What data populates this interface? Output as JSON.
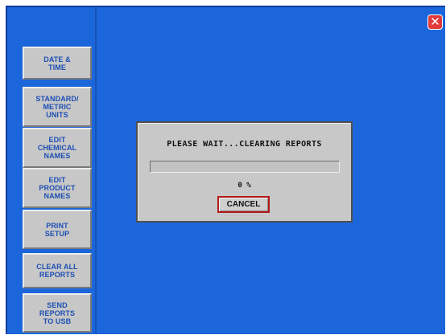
{
  "sidebar": {
    "items": [
      {
        "name": "sidebar-button-date-time",
        "label": "DATE &\nTIME"
      },
      {
        "name": "sidebar-button-standard-metric-units",
        "label": "STANDARD/\nMETRIC\nUNITS"
      },
      {
        "name": "sidebar-button-edit-chemical-names",
        "label": "EDIT\nCHEMICAL\nNAMES"
      },
      {
        "name": "sidebar-button-edit-product-names",
        "label": "EDIT\nPRODUCT\nNAMES"
      },
      {
        "name": "sidebar-button-print-setup",
        "label": "PRINT\nSETUP"
      },
      {
        "name": "sidebar-button-clear-all-reports",
        "label": "CLEAR ALL\nREPORTS"
      },
      {
        "name": "sidebar-button-send-reports-to-usb",
        "label": "SEND\nREPORTS\nTO USB"
      }
    ]
  },
  "close": {
    "label": "✕",
    "icon": "close-icon"
  },
  "dialog": {
    "title": "PLEASE WAIT...CLEARING REPORTS",
    "progress_percent": 0,
    "percent_label": "0 %",
    "cancel_label": "CANCEL"
  },
  "colors": {
    "background": "#1c66db",
    "button_face": "#c7c7c7",
    "button_text": "#1d4fb3",
    "close_button": "#e23a3a",
    "cancel_border": "#b31a1a"
  }
}
